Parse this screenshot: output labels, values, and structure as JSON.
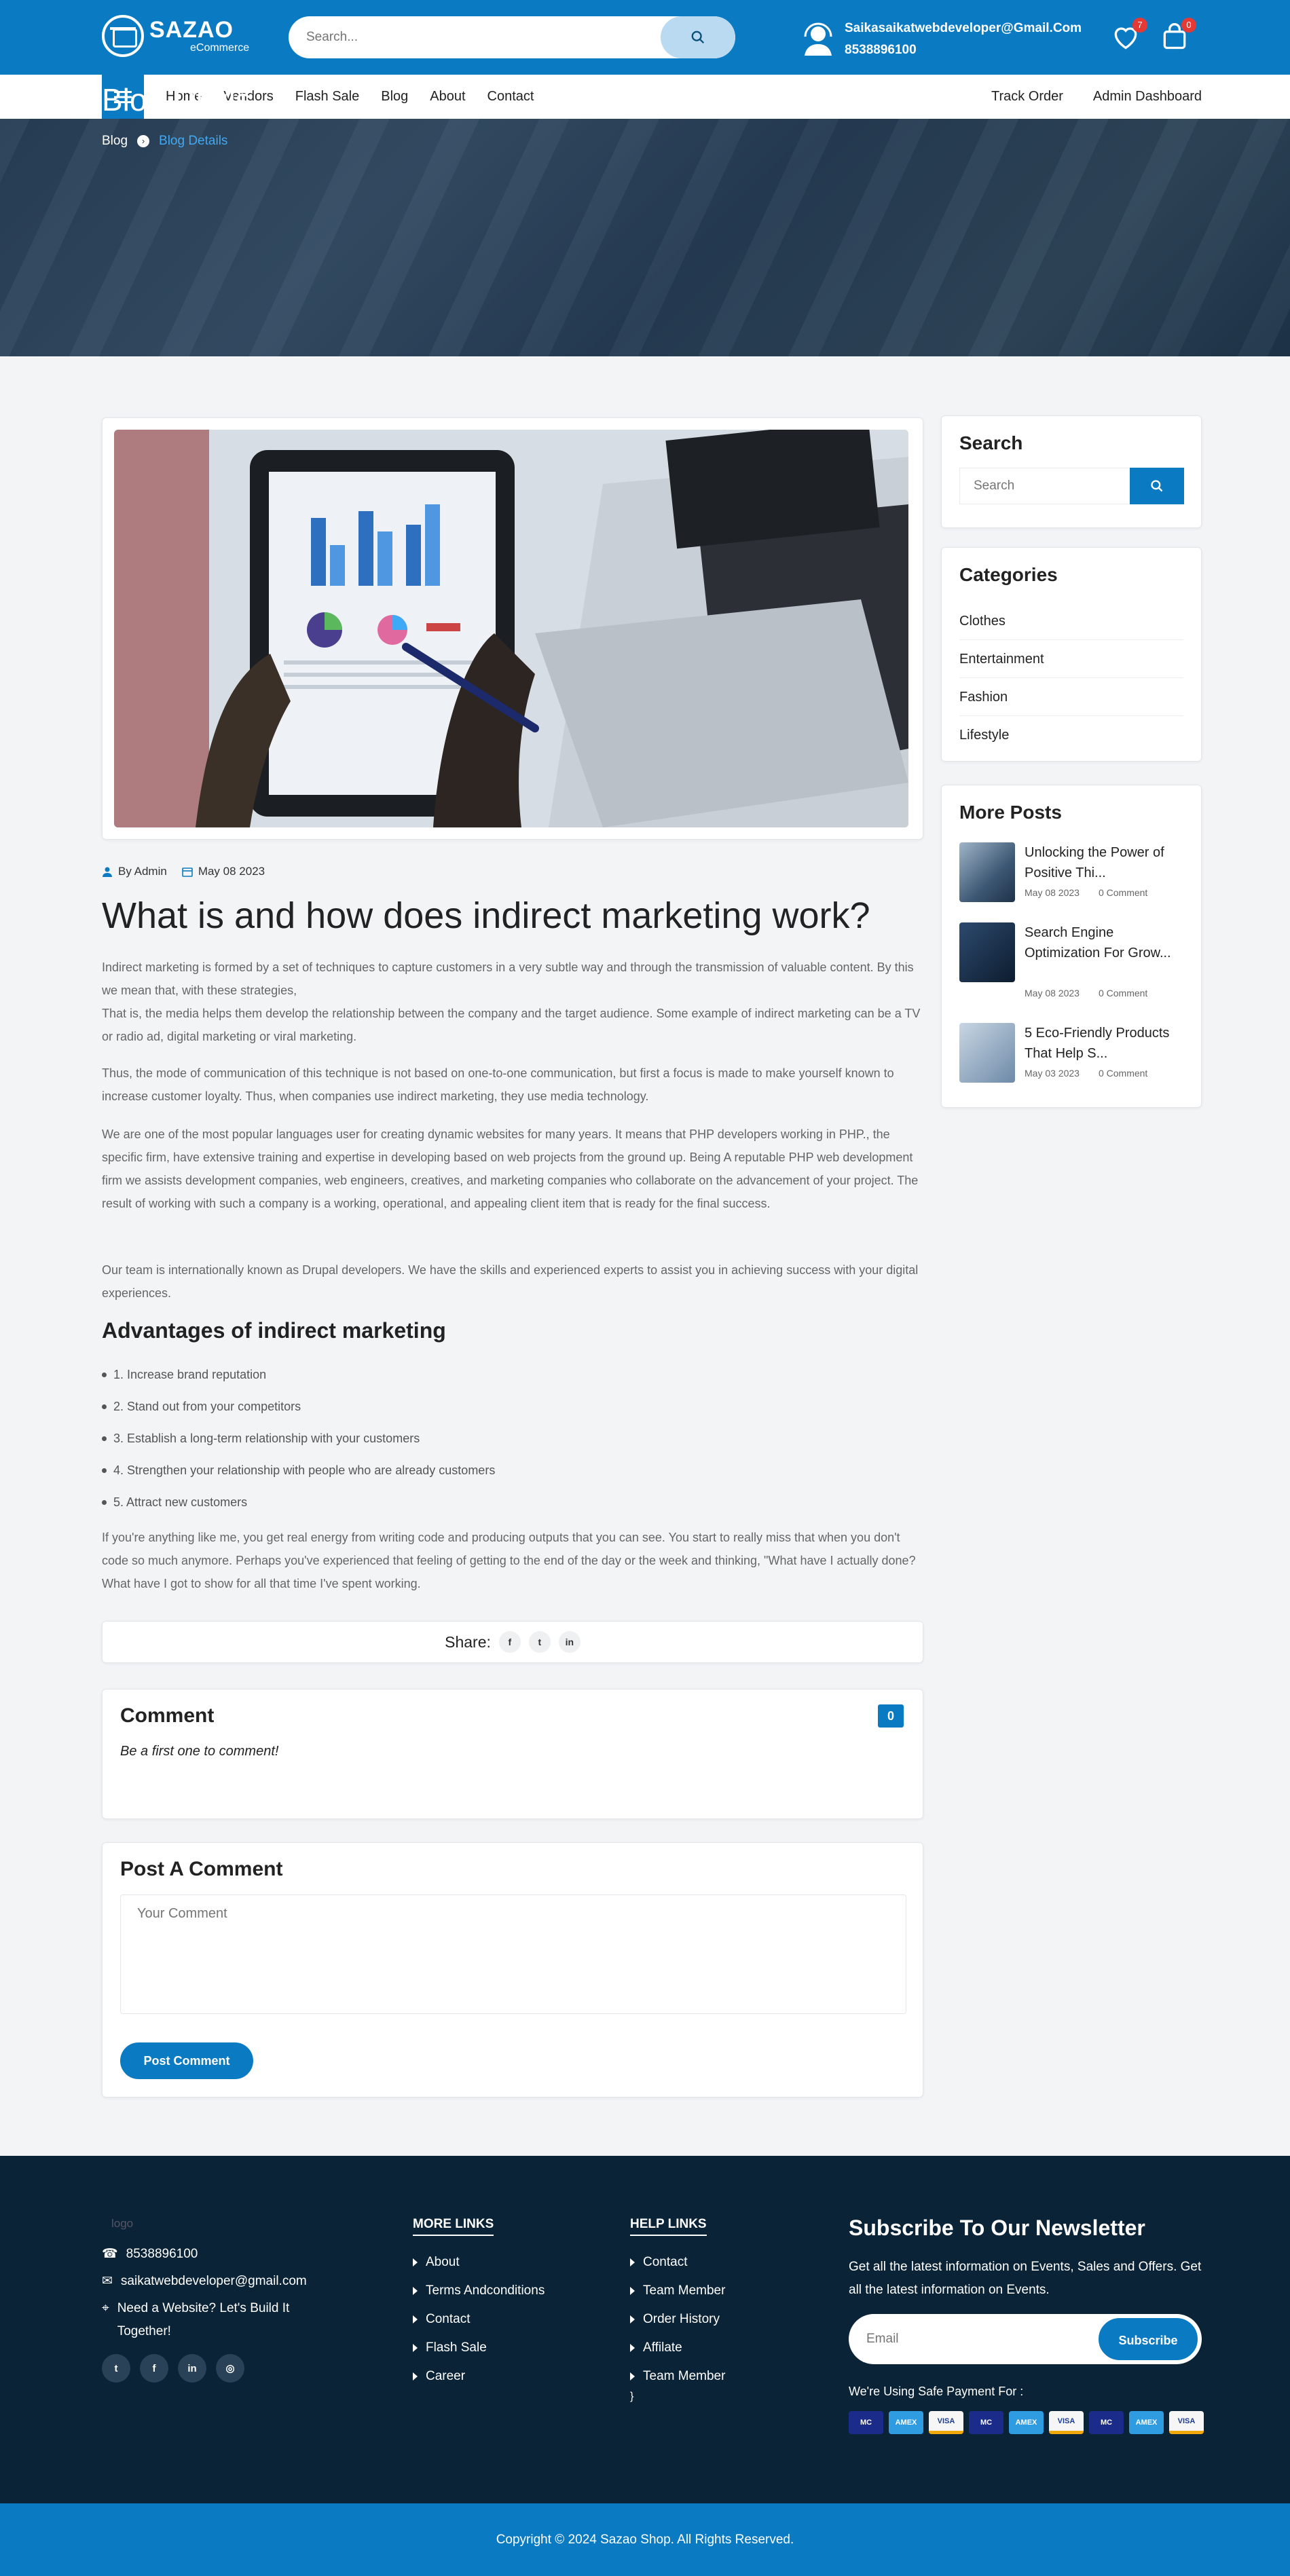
{
  "header": {
    "logo_main": "SAZAO",
    "logo_sub": "eCommerce",
    "search_placeholder": "Search...",
    "contact_email": "Saikasaikatwebdeveloper@Gmail.Com",
    "contact_phone": "8538896100",
    "wishlist_count": "7",
    "cart_count": "0"
  },
  "nav": {
    "links": [
      "Home",
      "Vendors",
      "Flash Sale",
      "Blog",
      "About",
      "Contact"
    ],
    "right": [
      "Track Order",
      "Admin Dashboard"
    ]
  },
  "hero": {
    "title": "Blog Dtails",
    "crumb_home": "Blog",
    "crumb_current": "Blog Details"
  },
  "article": {
    "author": "By Admin",
    "date": "May 08 2023",
    "title": "What is and how does indirect marketing work?",
    "p1": "Indirect marketing is formed by a set of techniques to capture customers in a very subtle way and through the transmission of valuable content. By this we mean that, with these strategies,",
    "p1b": "That is, the media helps them develop the relationship between the company and the target audience. Some example of indirect marketing can be a TV or radio ad, digital marketing or viral marketing.",
    "p2": "Thus, the mode of communication of this technique is not based on one-to-one communication, but first a focus is made to make yourself known to increase customer loyalty. Thus, when companies use indirect marketing, they use media technology.",
    "p3": "We are one of the most popular languages user for creating dynamic websites for many years. It means that PHP developers working in PHP., the specific firm, have extensive training and expertise in developing based on web projects from the ground up. Being A reputable PHP web development firm we assists development companies, web engineers, creatives, and marketing companies who collaborate on the advancement of your project. The result of working with such a company is a working, operational, and appealing client item that is ready for the final success.",
    "p4": "Our team is internationally known as Drupal developers. We have the skills and experienced experts to assist you in achieving success with your digital experiences.",
    "h2": "Advantages of indirect marketing",
    "list": [
      "1. Increase brand reputation",
      "2. Stand out from your competitors",
      "3. Establish a long-term relationship with your customers",
      "4. Strengthen your relationship with people who are already customers",
      "5. Attract new customers"
    ],
    "p5": "If you're anything like me, you get real energy from writing code and producing outputs that you can see. You start to really miss that when you don't code so much anymore. Perhaps you've experienced that feeling of getting to the end of the day or the week and thinking, \"What have I actually done? What have I got to show for all that time I've spent working.",
    "share_label": "Share:"
  },
  "comments": {
    "title": "Comment",
    "count": "0",
    "empty": "Be a first one to comment!",
    "form_title": "Post A Comment",
    "placeholder": "Your Comment",
    "button": "Post Comment"
  },
  "sidebar": {
    "search_title": "Search",
    "search_placeholder": "Search",
    "categories_title": "Categories",
    "categories": [
      "Clothes",
      "Entertainment",
      "Fashion",
      "Lifestyle"
    ],
    "more_title": "More Posts",
    "posts": [
      {
        "title": "Unlocking the Power of Positive Thi...",
        "date": "May 08 2023",
        "comments": "0 Comment"
      },
      {
        "title": "Search Engine Optimization For Grow...",
        "date": "May 08 2023",
        "comments": "0 Comment"
      },
      {
        "title": "5 Eco-Friendly Products That Help S...",
        "date": "May 03 2023",
        "comments": "0 Comment"
      }
    ]
  },
  "footer": {
    "logo_alt": "logo",
    "phone": "8538896100",
    "email": "saikatwebdeveloper@gmail.com",
    "tagline": "Need a Website? Let's Build It Together!",
    "more_head": "MORE LINKS",
    "more_links": [
      "About",
      "Terms Andconditions",
      "Contact",
      "Flash Sale",
      "Career"
    ],
    "help_head": "HELP LINKS",
    "help_links": [
      "Contact",
      "Team Member",
      "Order History",
      "Affilate",
      "Team Member"
    ],
    "nl_title": "Subscribe To Our Newsletter",
    "nl_text": "Get all the latest information on Events, Sales and Offers. Get all the latest information on Events.",
    "nl_placeholder": "Email",
    "nl_button": "Subscribe",
    "pay_label": "We're Using Safe Payment For :",
    "pay_cards": [
      "MC",
      "AMEX",
      "VISA",
      "MC",
      "AMEX",
      "VISA",
      "MC",
      "AMEX",
      "VISA"
    ],
    "copyright": "Copyright © 2024 Sazao Shop. All Rights Reserved."
  },
  "colors": {
    "primary": "#0a7bc2",
    "footer": "#0b2337",
    "badge": "#e53935"
  }
}
